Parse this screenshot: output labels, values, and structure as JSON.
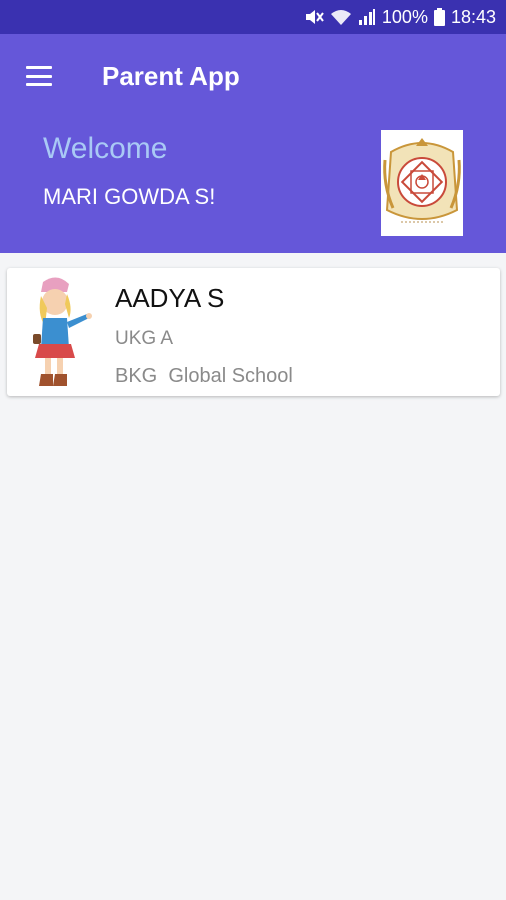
{
  "status_bar": {
    "battery": "100%",
    "time": "18:43",
    "icons": [
      "mute-icon",
      "wifi-icon",
      "signal-icon",
      "battery-icon"
    ]
  },
  "app_bar": {
    "title": "Parent App",
    "menu_icon": "hamburger-menu-icon"
  },
  "header": {
    "welcome": "Welcome",
    "user_name": "MARI GOWDA S!"
  },
  "students": [
    {
      "name": "AADYA S",
      "class": "UKG A",
      "school": "BKG  Global School"
    }
  ],
  "colors": {
    "status_bar": "#3a31b0",
    "primary": "#6557d9",
    "welcome_text": "#a9c9f5",
    "background": "#f4f5f7"
  }
}
